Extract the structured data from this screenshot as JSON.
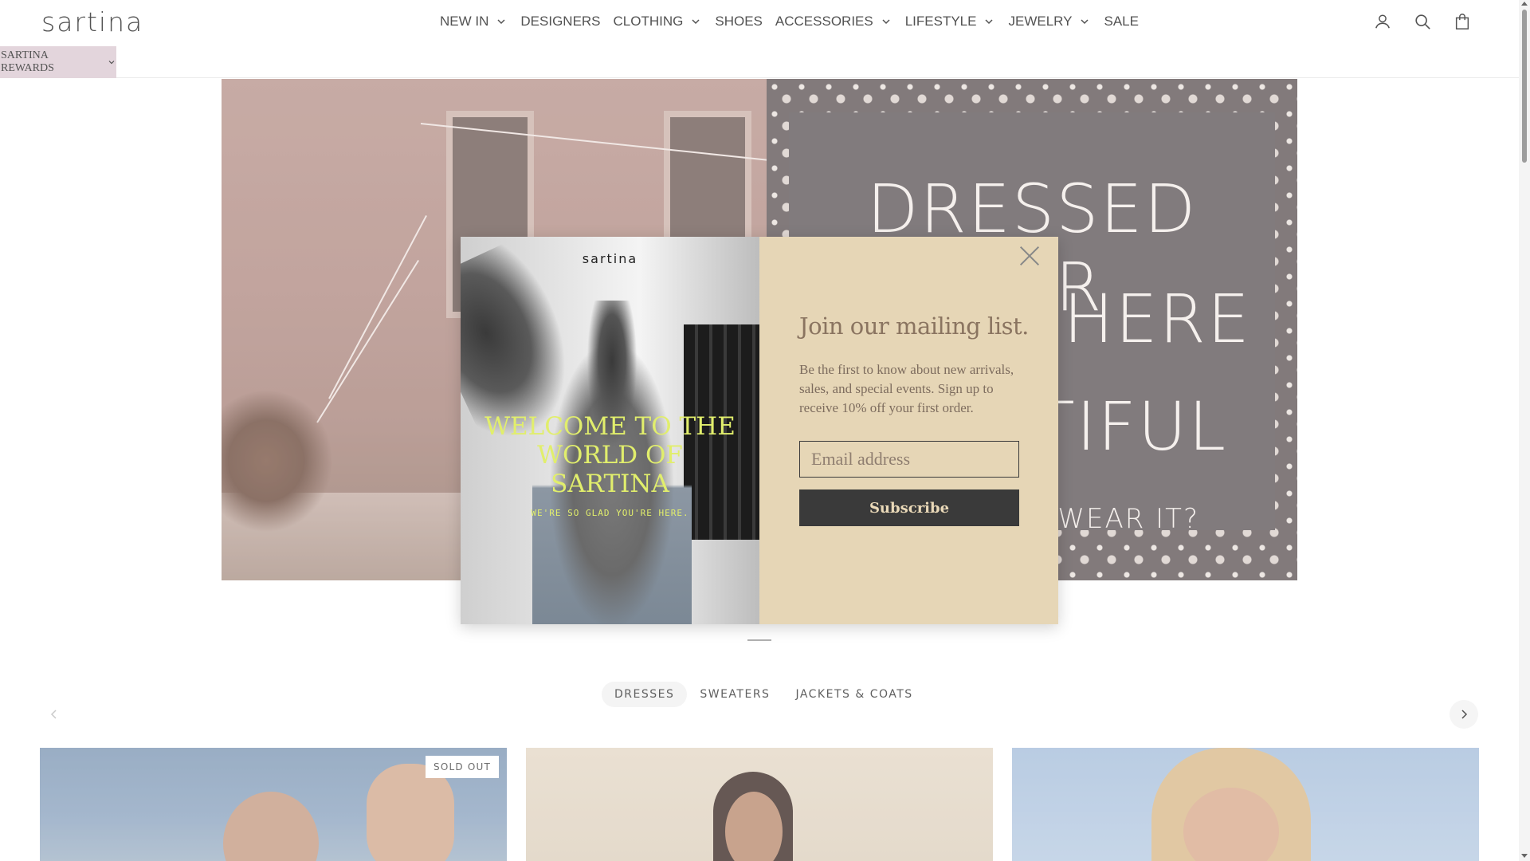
{
  "header": {
    "logo": "sartina",
    "nav": [
      {
        "label": "NEW IN",
        "dropdown": true
      },
      {
        "label": "DESIGNERS",
        "dropdown": false
      },
      {
        "label": "CLOTHING",
        "dropdown": true
      },
      {
        "label": "SHOES",
        "dropdown": false
      },
      {
        "label": "ACCESSORIES",
        "dropdown": true
      },
      {
        "label": "LIFESTYLE",
        "dropdown": true
      },
      {
        "label": "JEWELRY",
        "dropdown": true
      },
      {
        "label": "SALE",
        "dropdown": false
      }
    ],
    "icons": [
      "account-icon",
      "search-icon",
      "cart-icon"
    ]
  },
  "rewards": {
    "label": "SARTINA REWARDS"
  },
  "hero": {
    "line1": "DRESSED FOR",
    "line2": "WHERE",
    "line3": "TIFUL",
    "line4": "U WEAR IT?"
  },
  "popup": {
    "image_logo": "sartina",
    "welcome": "WELCOME TO THE WORLD OF SARTINA",
    "glad": "WE'RE SO GLAD YOU'RE HERE.",
    "title": "Join our mailing list.",
    "body": "Be the first to know about new arrivals, sales, and special events. Sign up to receive 10% off your first order.",
    "email_placeholder": "Email address",
    "subscribe_label": "Subscribe"
  },
  "tabs": [
    {
      "label": "DRESSES",
      "active": true
    },
    {
      "label": "SWEATERS",
      "active": false
    },
    {
      "label": "JACKETS & COATS",
      "active": false
    }
  ],
  "products": [
    {
      "badge": "SOLD OUT"
    },
    {
      "badge": ""
    },
    {
      "badge": ""
    }
  ],
  "colors": {
    "rewards_bg": "#dccad3",
    "popup_form_bg": "#e6d6b6",
    "welcome_text": "#e1ee6c",
    "subscribe_bg": "#3a3a3a"
  }
}
